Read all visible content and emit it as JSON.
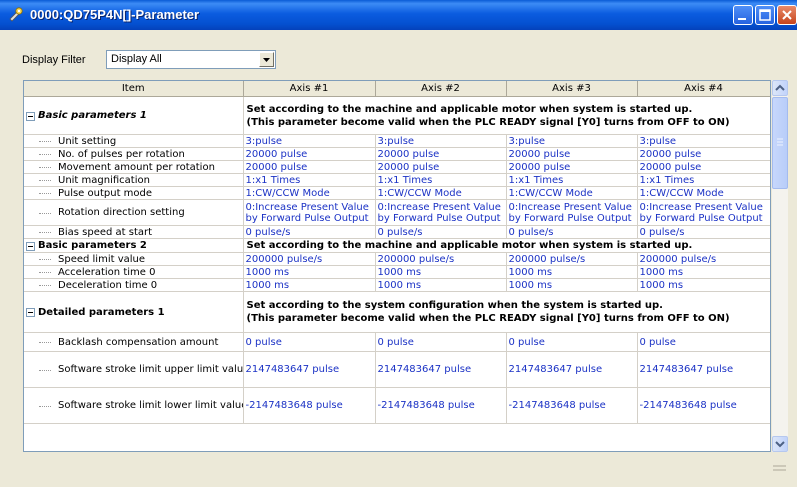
{
  "window": {
    "title": "0000:QD75P4N[]-Parameter"
  },
  "filter": {
    "label": "Display Filter",
    "value": "Display All"
  },
  "table": {
    "headers": [
      "Item",
      "Axis #1",
      "Axis #2",
      "Axis #3",
      "Axis #4"
    ],
    "groups": [
      {
        "name": "Basic parameters 1",
        "desc1": "Set according to the machine and applicable motor when system is started up.",
        "desc2": "(This parameter become valid when the PLC READY signal [Y0] turns from OFF to ON)"
      },
      {
        "name": "Basic parameters 2",
        "desc1": "Set according to the machine and applicable motor when system is started up."
      },
      {
        "name": "Detailed parameters 1",
        "desc1": "Set according to the system configuration when the system is started up.",
        "desc2": "(This parameter become valid when the PLC READY signal [Y0] turns from OFF to ON)"
      }
    ],
    "rows": [
      {
        "label": "Unit setting",
        "values": [
          "3:pulse",
          "3:pulse",
          "3:pulse",
          "3:pulse"
        ]
      },
      {
        "label": "No. of pulses per rotation",
        "values": [
          "20000 pulse",
          "20000 pulse",
          "20000 pulse",
          "20000 pulse"
        ]
      },
      {
        "label": "Movement amount per rotation",
        "values": [
          "20000 pulse",
          "20000 pulse",
          "20000 pulse",
          "20000 pulse"
        ]
      },
      {
        "label": "Unit magnification",
        "values": [
          "1:x1 Times",
          "1:x1 Times",
          "1:x1 Times",
          "1:x1 Times"
        ]
      },
      {
        "label": "Pulse output mode",
        "values": [
          "1:CW/CCW Mode",
          "1:CW/CCW Mode",
          "1:CW/CCW Mode",
          "1:CW/CCW Mode"
        ]
      },
      {
        "label": "Rotation direction setting",
        "line1": "0:Increase Present Value",
        "line2": "by Forward Pulse Output"
      },
      {
        "label": "Bias speed at start",
        "values": [
          "0 pulse/s",
          "0 pulse/s",
          "0 pulse/s",
          "0 pulse/s"
        ]
      },
      {
        "label": "Speed limit value",
        "values": [
          "200000 pulse/s",
          "200000 pulse/s",
          "200000 pulse/s",
          "200000 pulse/s"
        ]
      },
      {
        "label": "Acceleration time 0",
        "values": [
          "1000 ms",
          "1000 ms",
          "1000 ms",
          "1000 ms"
        ]
      },
      {
        "label": "Deceleration time 0",
        "values": [
          "1000 ms",
          "1000 ms",
          "1000 ms",
          "1000 ms"
        ]
      },
      {
        "label": "Backlash compensation amount",
        "values": [
          "0 pulse",
          "0 pulse",
          "0 pulse",
          "0 pulse"
        ]
      },
      {
        "label": "Software stroke limit upper limit value",
        "values": [
          "2147483647 pulse",
          "2147483647 pulse",
          "2147483647 pulse",
          "2147483647 pulse"
        ]
      },
      {
        "label": "Software stroke limit lower limit value",
        "values": [
          "-2147483648 pulse",
          "-2147483648 pulse",
          "-2147483648 pulse",
          "-2147483648 pulse"
        ]
      }
    ]
  }
}
